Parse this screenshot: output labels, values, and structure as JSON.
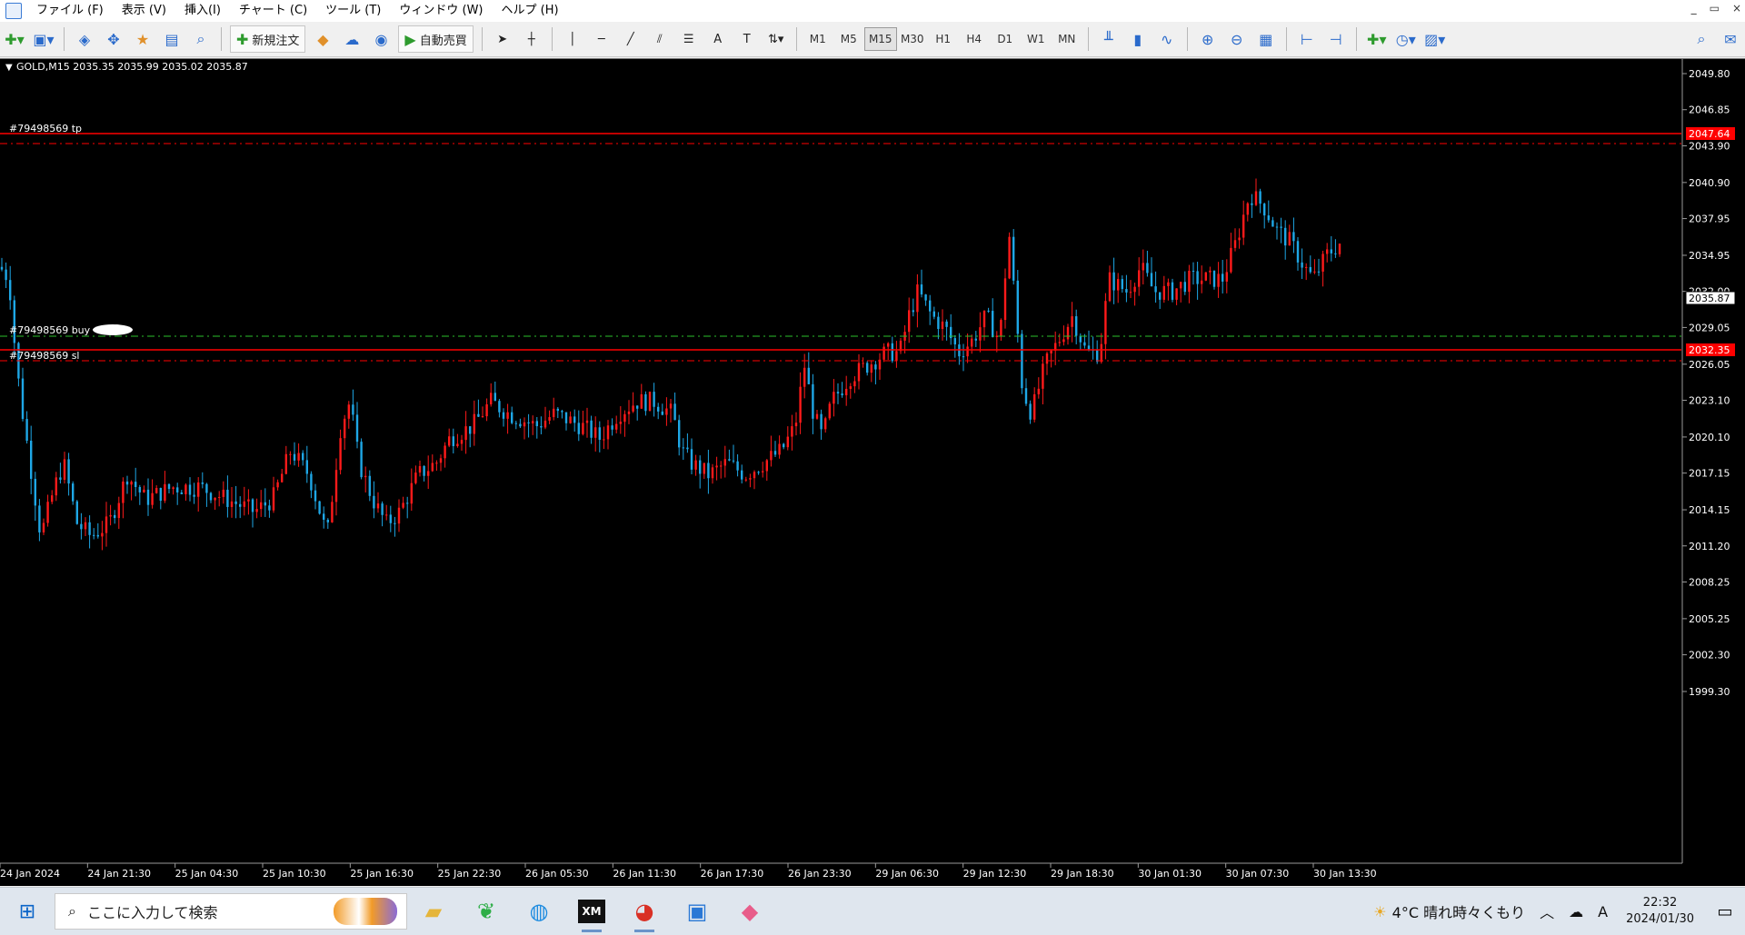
{
  "menu": [
    "ファイル (F)",
    "表示 (V)",
    "挿入(I)",
    "チャート (C)",
    "ツール (T)",
    "ウィンドウ (W)",
    "ヘルプ (H)"
  ],
  "window_controls": [
    "_",
    "▭",
    "×"
  ],
  "toolbar": {
    "new_order_label": "新規注文",
    "auto_trade_label": "自動売買",
    "timeframes": [
      "M1",
      "M5",
      "M15",
      "M30",
      "H1",
      "H4",
      "D1",
      "W1",
      "MN"
    ],
    "active_timeframe": "M15"
  },
  "chart": {
    "header": "GOLD,M15  2035.35 2035.99 2035.02 2035.87",
    "price_labels": [
      "2049.80",
      "2046.85",
      "2043.90",
      "2040.90",
      "2037.95",
      "2034.95",
      "2032.00",
      "2029.05",
      "2026.05",
      "2023.10",
      "2020.10",
      "2017.15",
      "2014.15",
      "2011.20",
      "2008.25",
      "2005.25",
      "2002.30",
      "1999.30"
    ],
    "time_labels": [
      "24 Jan 2024",
      "24 Jan 21:30",
      "25 Jan 04:30",
      "25 Jan 10:30",
      "25 Jan 16:30",
      "25 Jan 22:30",
      "26 Jan 05:30",
      "26 Jan 11:30",
      "26 Jan 17:30",
      "26 Jan 23:30",
      "29 Jan 06:30",
      "29 Jan 12:30",
      "29 Jan 18:30",
      "30 Jan 01:30",
      "30 Jan 07:30",
      "30 Jan 13:30"
    ],
    "current_price": "2035.87",
    "tp_line": {
      "label": "#79498569 tp",
      "price_box": "2047.64"
    },
    "buy_line": {
      "label": "#79498569 buy"
    },
    "sl_line": {
      "label": "#79498569 sl",
      "price_box": "2032.35"
    },
    "colors": {
      "bull": "#ff1a1a",
      "bear": "#1ea7e6",
      "tp_sl": "#ff0000",
      "buy": "#2bbf2b",
      "background": "#000000"
    }
  },
  "taskbar": {
    "search_placeholder": "ここに入力して検索",
    "weather": "4°C  晴れ時々くもり",
    "ime": "A",
    "time": "22:32",
    "date": "2024/01/30"
  }
}
